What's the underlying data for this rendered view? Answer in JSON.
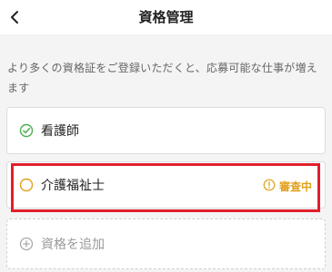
{
  "header": {
    "title": "資格管理",
    "back_icon": "chevron-left-icon"
  },
  "notice": "より多くの資格証をご登録いただくと、応募可能な仕事が増えます",
  "qualifications": [
    {
      "name": "看護師",
      "icon": "check-circle-icon",
      "status": "",
      "icon_color": "#4caf50"
    },
    {
      "name": "介護福祉士",
      "icon": "circle-outline-icon",
      "status": "審査中",
      "icon_color": "#e0a01c"
    }
  ],
  "add_button": {
    "label": "資格を追加",
    "icon": "plus-circle-icon"
  },
  "colors": {
    "status_pending": "#e0a01c",
    "verified": "#4caf50",
    "highlight": "#e21f2b"
  }
}
